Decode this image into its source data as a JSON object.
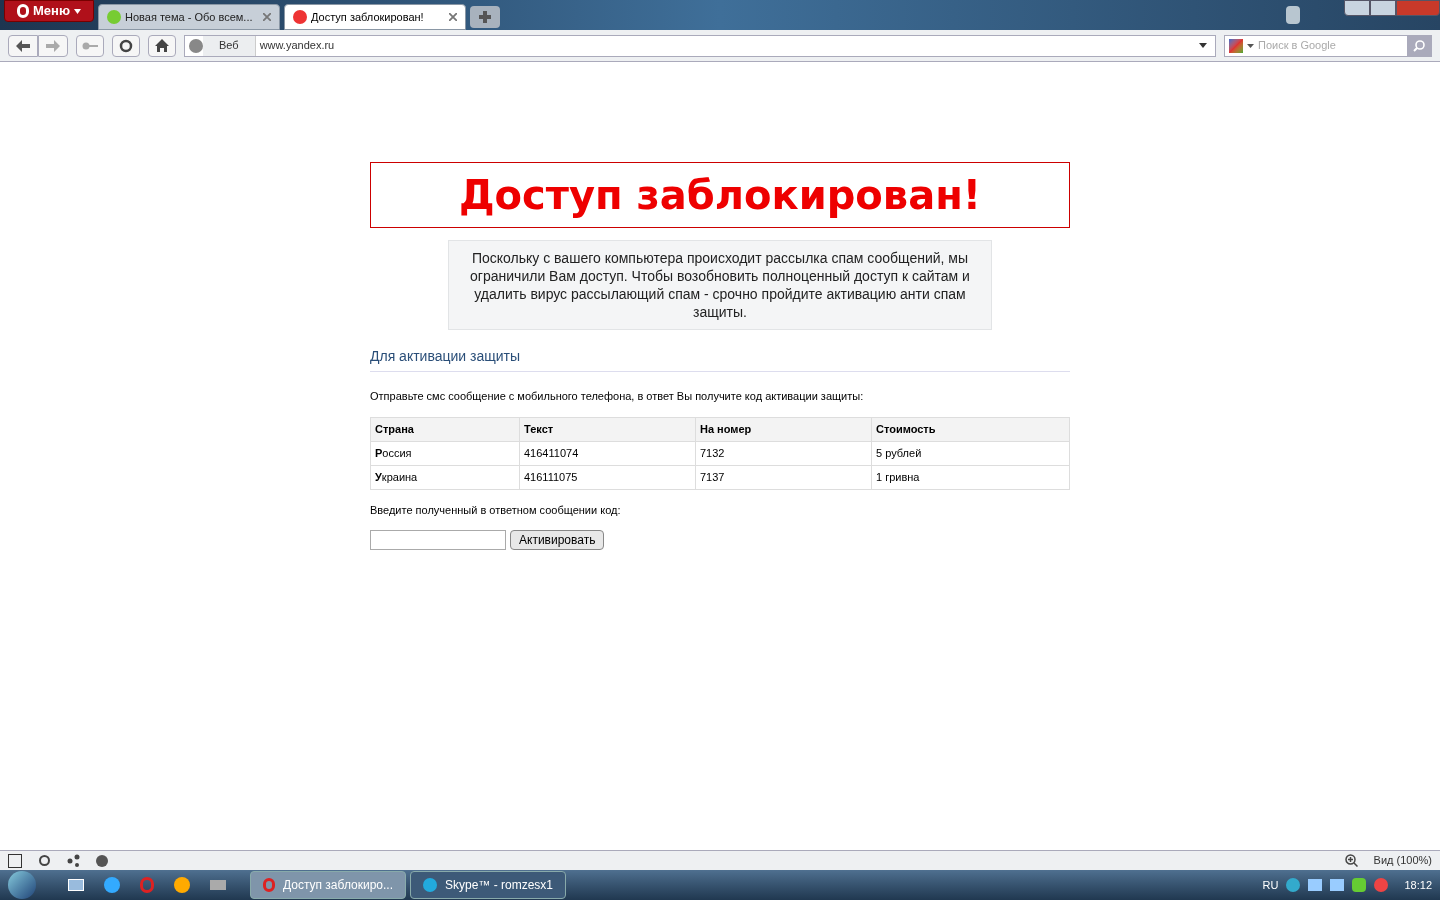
{
  "browser": {
    "menu_label": "Меню",
    "tabs": [
      {
        "title": "Новая тема - Обо всем...",
        "selected": false
      },
      {
        "title": "Доступ заблокирован!",
        "selected": true
      }
    ],
    "address_label": "Веб",
    "url": "www.yandex.ru",
    "search": {
      "placeholder": "Поиск в Google"
    }
  },
  "page": {
    "heading": "Доступ заблокирован!",
    "notice": "Поскольку с вашего компьютера происходит рассылка спам сообщений, мы ограничили Вам доступ. Чтобы возобновить полноценный доступ к сайтам и удалить вирус рассылающий спам - срочно пройдите активацию анти спам защиты.",
    "section_title": "Для активации защиты",
    "instruction": "Отправьте смс сообщение с мобильного телефона, в ответ Вы получите код активации защиты:",
    "table": {
      "columns": [
        "Страна",
        "Текст",
        "На номер",
        "Стоимость"
      ],
      "rows": [
        [
          "**Р**оссия",
          "416411074",
          "7132",
          "5 рублей"
        ],
        [
          "**У**краина",
          "416111075",
          "7137",
          "1 гривна"
        ]
      ]
    },
    "code_label": "Введите полученный в ответном сообщении код:",
    "activate_button": "Активировать"
  },
  "status_bar": {
    "zoom": "Вид (100%)"
  },
  "taskbar": {
    "windows": [
      {
        "title": "Доступ заблокиро...",
        "selected": true,
        "kind": "opera"
      },
      {
        "title": "Skype™ - romzesx1",
        "selected": false,
        "kind": "skype"
      }
    ],
    "language": "RU",
    "clock": "18:12"
  }
}
